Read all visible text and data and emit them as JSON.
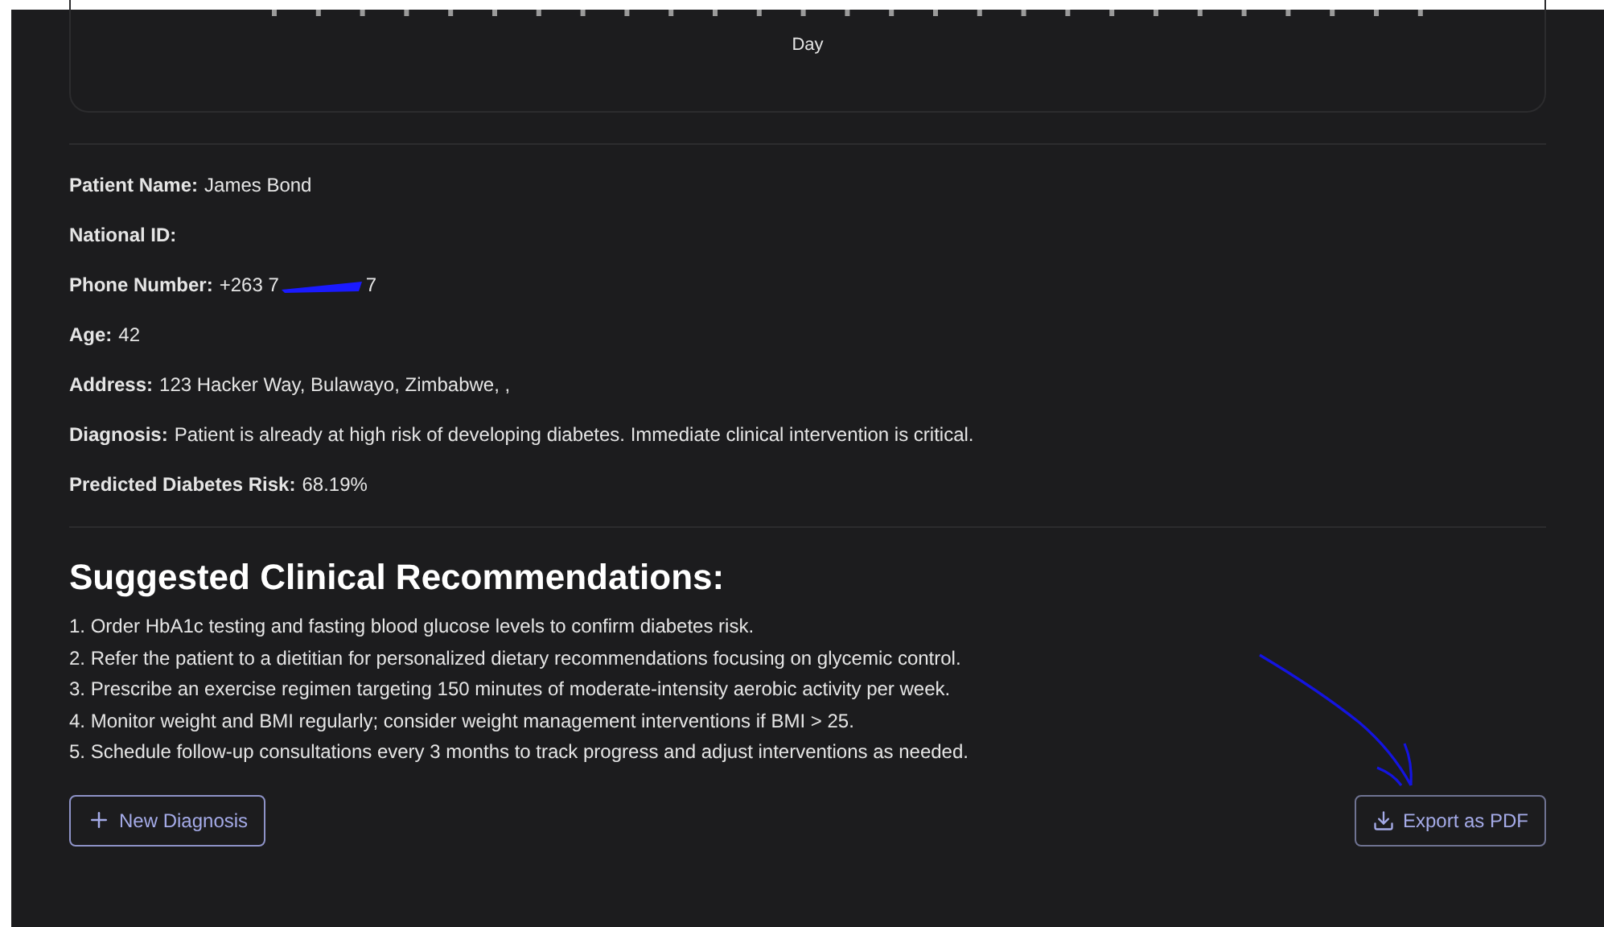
{
  "chart": {
    "xlabel": "Day"
  },
  "fields": [
    {
      "label": "Patient Name:",
      "value": "James Bond"
    },
    {
      "label": "National ID:"
    },
    {
      "label": "Phone Number:",
      "value": "+263 7",
      "redacted": true,
      "value_end": "7"
    },
    {
      "label": "Age:",
      "value": "42"
    },
    {
      "label": "Address:",
      "value": "123 Hacker Way, Bulawayo, Zimbabwe, ,"
    },
    {
      "label": "Diagnosis:",
      "value": "Patient is already at high risk of developing diabetes. Immediate clinical intervention is critical."
    },
    {
      "label": "Predicted Diabetes Risk:",
      "value": "68.19%"
    }
  ],
  "recommendations": {
    "title": "Suggested Clinical Recommendations:",
    "items": [
      "1. Order HbA1c testing and fasting blood glucose levels to confirm diabetes risk.",
      "2. Refer the patient to a dietitian for personalized dietary recommendations focusing on glycemic control.",
      "3. Prescribe an exercise regimen targeting 150 minutes of moderate-intensity aerobic activity per week.",
      "4. Monitor weight and BMI regularly; consider weight management interventions if BMI > 25.",
      "5. Schedule follow-up consultations every 3 months to track progress and adjust interventions as needed."
    ]
  },
  "buttons": {
    "new": "New Diagnosis",
    "export": "Export as PDF"
  }
}
